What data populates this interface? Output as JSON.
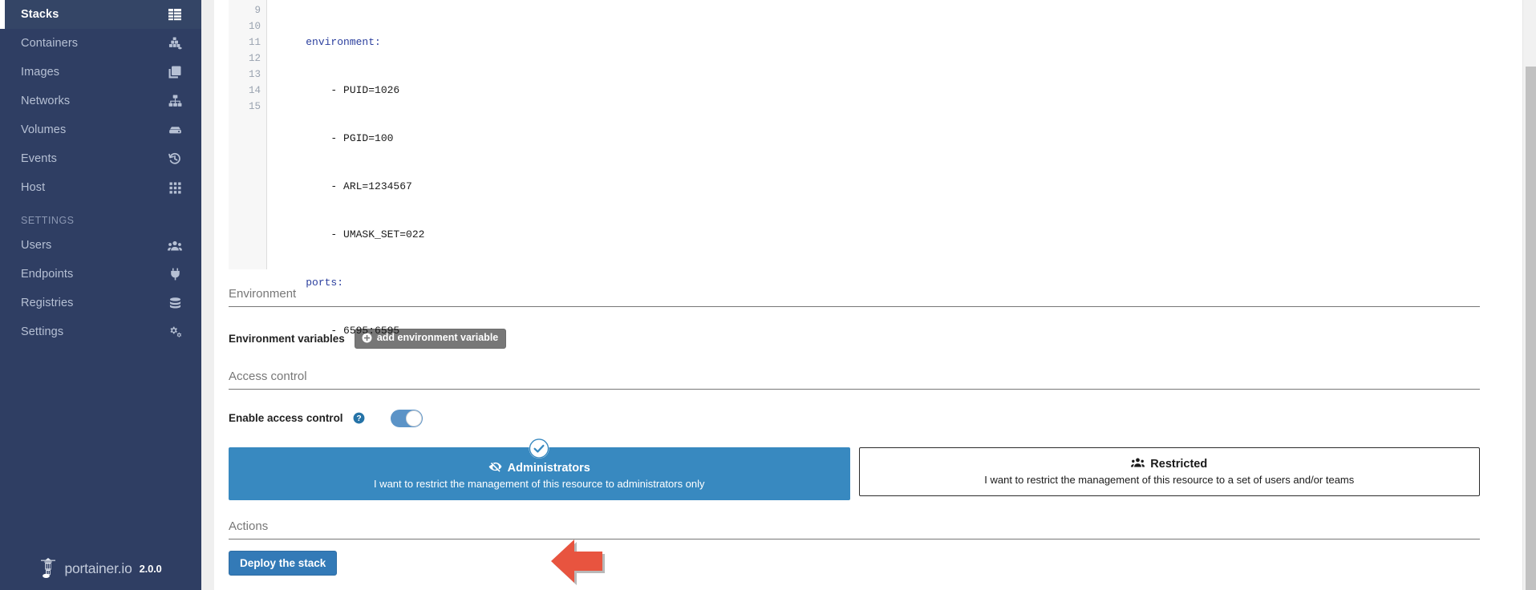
{
  "sidebar": {
    "items": [
      {
        "label": "Stacks",
        "icon": "stacks-icon",
        "active": true
      },
      {
        "label": "Containers",
        "icon": "containers-icon",
        "active": false
      },
      {
        "label": "Images",
        "icon": "images-icon",
        "active": false
      },
      {
        "label": "Networks",
        "icon": "networks-icon",
        "active": false
      },
      {
        "label": "Volumes",
        "icon": "volumes-icon",
        "active": false
      },
      {
        "label": "Events",
        "icon": "events-icon",
        "active": false
      },
      {
        "label": "Host",
        "icon": "host-icon",
        "active": false
      }
    ],
    "section_label": "SETTINGS",
    "settings_items": [
      {
        "label": "Users",
        "icon": "users-icon"
      },
      {
        "label": "Endpoints",
        "icon": "endpoints-icon"
      },
      {
        "label": "Registries",
        "icon": "registries-icon"
      },
      {
        "label": "Settings",
        "icon": "settings-icon"
      }
    ],
    "footer": {
      "brand": "portainer.io",
      "version": "2.0.0",
      "logo_icon": "portainer-lighthouse-icon"
    },
    "colors": {
      "background": "#2f3e63",
      "active_background": "#344566",
      "text": "#b6c0d4",
      "active_marker": "#ffffff"
    }
  },
  "editor": {
    "language": "yaml",
    "first_visible_line": 9,
    "lines": [
      {
        "number": "9",
        "indent": 4,
        "key": "environment:",
        "value": ""
      },
      {
        "number": "10",
        "indent": 8,
        "key": "",
        "value": "- PUID=1026"
      },
      {
        "number": "11",
        "indent": 8,
        "key": "",
        "value": "- PGID=100"
      },
      {
        "number": "12",
        "indent": 8,
        "key": "",
        "value": "- ARL=1234567"
      },
      {
        "number": "13",
        "indent": 8,
        "key": "",
        "value": "- UMASK_SET=022"
      },
      {
        "number": "14",
        "indent": 4,
        "key": "ports:",
        "value": ""
      },
      {
        "number": "15",
        "indent": 8,
        "key": "",
        "value": "- 6595:6595"
      }
    ],
    "colors": {
      "key": "#2b3f9e",
      "text": "#1b1b1b",
      "gutter_bg": "#f7f7f7",
      "gutter_text": "#9aa3b0"
    }
  },
  "environment_section": {
    "heading": "Environment",
    "variables_label": "Environment variables",
    "add_button_label": "add environment variable",
    "add_button_icon": "plus-circle-icon"
  },
  "access_control_section": {
    "heading": "Access control",
    "enable_label": "Enable access control",
    "help_icon": "question-circle-icon",
    "toggle_state": "on",
    "toggle_color": "#5b93c7",
    "options": [
      {
        "title": "Administrators",
        "icon": "eye-slash-icon",
        "description": "I want to restrict the management of this resource to administrators only",
        "selected": true,
        "check_icon": "check-circle-icon",
        "background": "#3889c0"
      },
      {
        "title": "Restricted",
        "icon": "users-group-icon",
        "description": "I want to restrict the management of this resource to a set of users and/or teams",
        "selected": false,
        "background": "#ffffff"
      }
    ]
  },
  "actions_section": {
    "heading": "Actions",
    "deploy_button_label": "Deploy the stack",
    "deploy_button_color": "#337ab7"
  },
  "annotation": {
    "arrow_icon": "left-pointing-arrow-annotation",
    "color": "#e8543f"
  }
}
